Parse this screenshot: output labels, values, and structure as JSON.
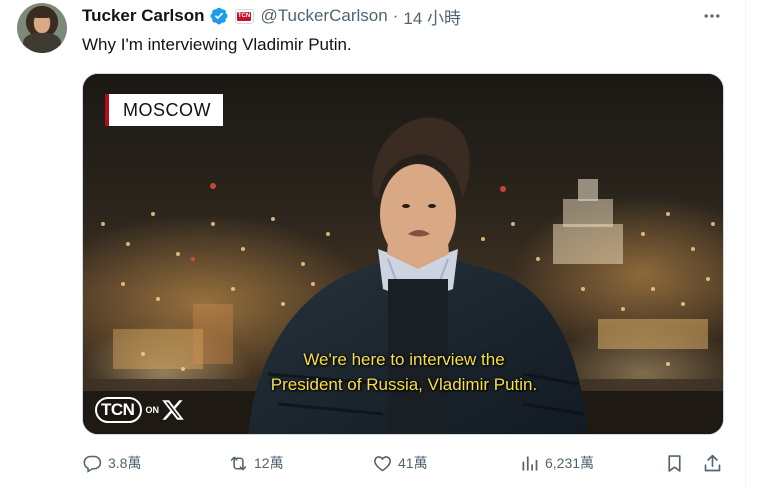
{
  "post": {
    "author_name": "Tucker Carlson",
    "handle": "@TuckerCarlson",
    "separator": "·",
    "time": "14 小時",
    "affiliation_badge_text": "TCN",
    "text": "Why I'm interviewing Vladimir Putin."
  },
  "media": {
    "location_tag": "MOSCOW",
    "subtitle_line1": "We're here to interview the",
    "subtitle_line2": "President of Russia, Vladimir Putin.",
    "network_logo": "TCN",
    "network_on": "ON"
  },
  "actions": {
    "replies": "3.8萬",
    "reposts": "12萬",
    "likes": "41萬",
    "views": "6,231萬"
  },
  "icons": {
    "verified": "verified-badge-icon",
    "more": "more-horizontal-icon",
    "reply": "reply-icon",
    "repost": "repost-icon",
    "like": "heart-icon",
    "views": "bar-chart-icon",
    "bookmark": "bookmark-icon",
    "share": "share-icon"
  },
  "colors": {
    "verified_blue": "#1d9bf0",
    "text_primary": "#0f1419",
    "text_secondary": "#536471",
    "subtitle_yellow": "#f6df4a",
    "tag_accent_red": "#b30d1d"
  }
}
